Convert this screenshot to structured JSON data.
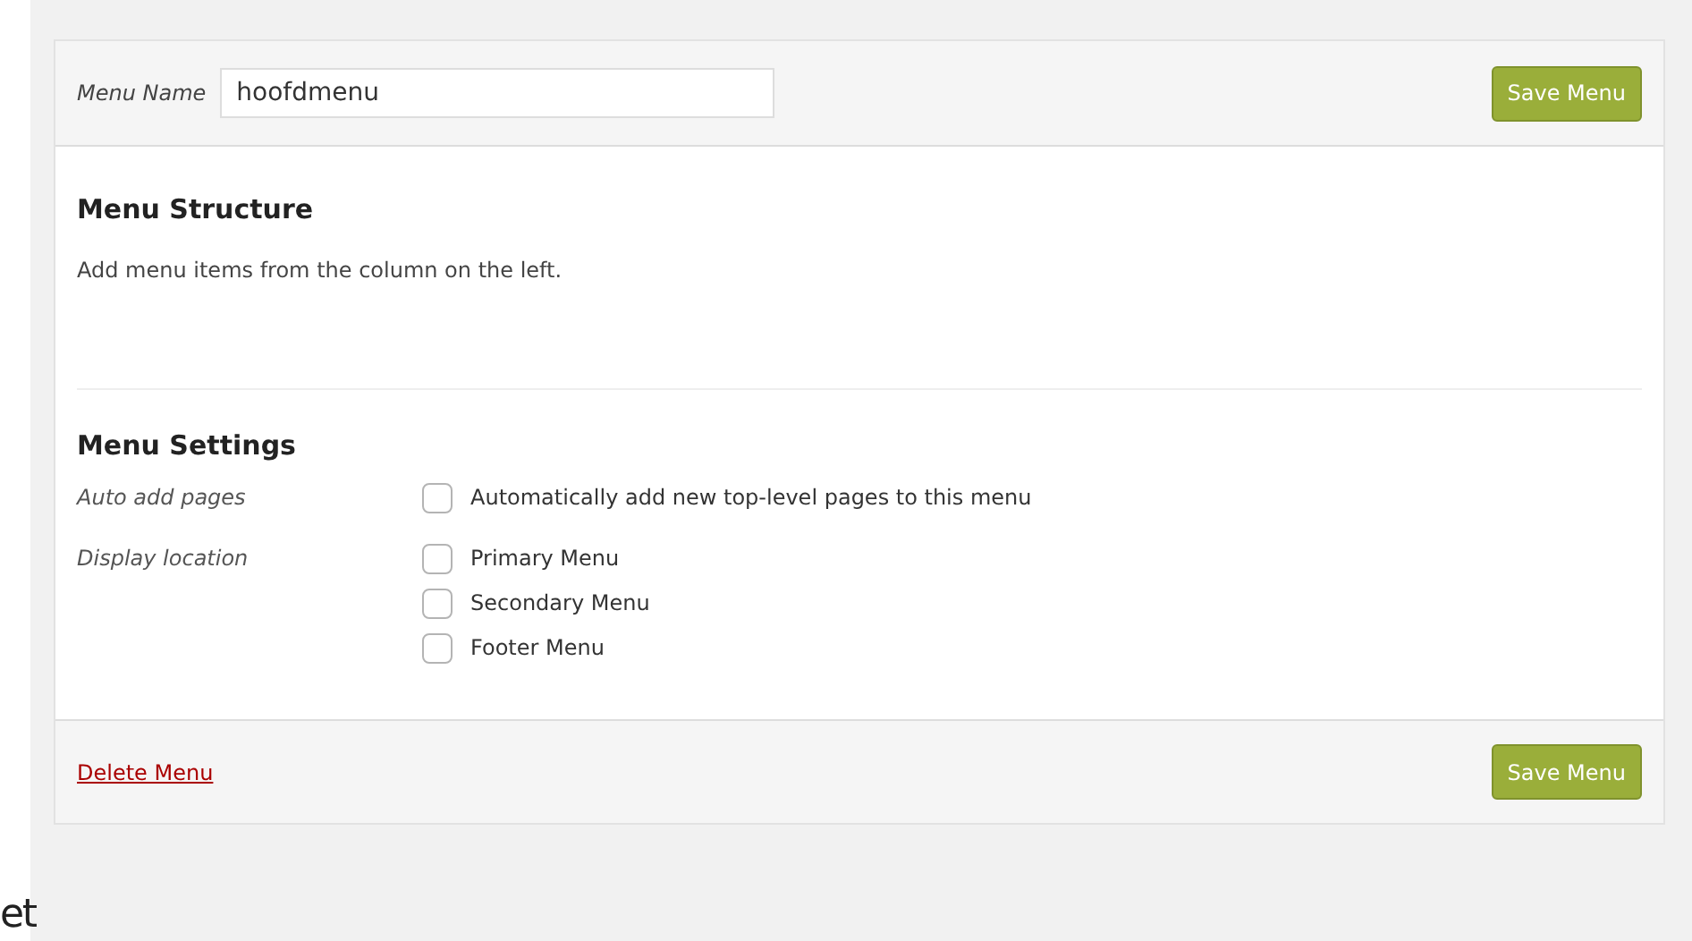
{
  "header": {
    "menu_name_label": "Menu Name",
    "menu_name_value": "hoofdmenu",
    "save_button": "Save Menu"
  },
  "structure": {
    "title": "Menu Structure",
    "hint": "Add menu items from the column on the left."
  },
  "settings": {
    "title": "Menu Settings",
    "groups": [
      {
        "label": "Auto add pages",
        "options": [
          {
            "label": "Automatically add new top-level pages to this menu",
            "checked": false
          }
        ]
      },
      {
        "label": "Display location",
        "options": [
          {
            "label": "Primary Menu",
            "checked": false
          },
          {
            "label": "Secondary Menu",
            "checked": false
          },
          {
            "label": "Footer Menu",
            "checked": false
          }
        ]
      }
    ]
  },
  "footer": {
    "delete_link": "Delete Menu",
    "save_button": "Save Menu"
  },
  "edge_text": "et"
}
